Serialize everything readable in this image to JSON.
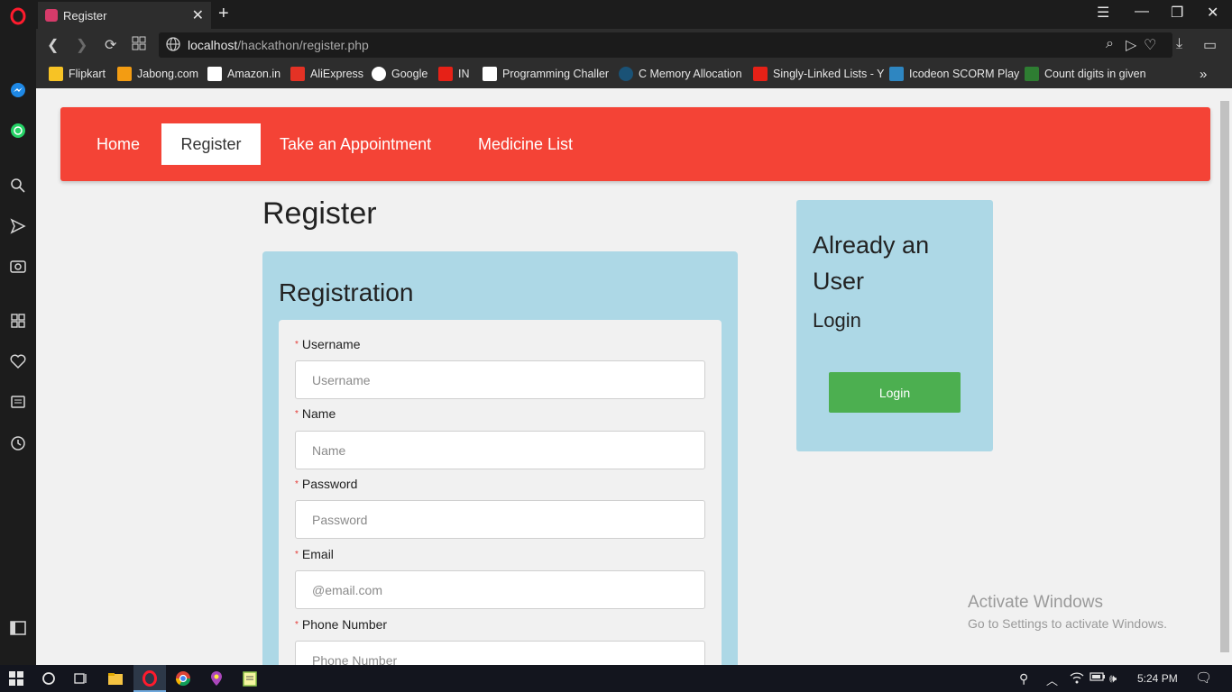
{
  "browser": {
    "tab_title": "Register",
    "url_host": "localhost",
    "url_path": "/hackathon/register.php",
    "bookmarks": [
      "Flipkart",
      "Jabong.com",
      "Amazon.in",
      "AliExpress",
      "Google",
      "IN",
      "Programming Challer",
      "C Memory Allocation",
      "Singly-Linked Lists - Y",
      "Icodeon SCORM Play",
      "Count digits in given"
    ],
    "more_bookmarks": "»"
  },
  "navbar": {
    "items": [
      {
        "label": "Home",
        "active": false
      },
      {
        "label": "Register",
        "active": true
      },
      {
        "label": "Take an Appointment",
        "active": false
      },
      {
        "label": "Medicine List",
        "active": false
      }
    ]
  },
  "page": {
    "title": "Register"
  },
  "registration": {
    "title": "Registration",
    "fields": [
      {
        "label": "Username",
        "placeholder": "Username"
      },
      {
        "label": "Name",
        "placeholder": "Name"
      },
      {
        "label": "Password",
        "placeholder": "Password"
      },
      {
        "label": "Email",
        "placeholder": "@email.com"
      },
      {
        "label": "Phone Number",
        "placeholder": "Phone Number"
      }
    ]
  },
  "login_panel": {
    "heading": "Already an User",
    "subheading": "Login",
    "button": "Login"
  },
  "watermark": {
    "line1": "Activate Windows",
    "line2": "Go to Settings to activate Windows."
  },
  "taskbar": {
    "time": "5:24 PM"
  },
  "colors": {
    "navbar": "#f44336",
    "card": "#add8e6",
    "login_button": "#4caf50"
  }
}
